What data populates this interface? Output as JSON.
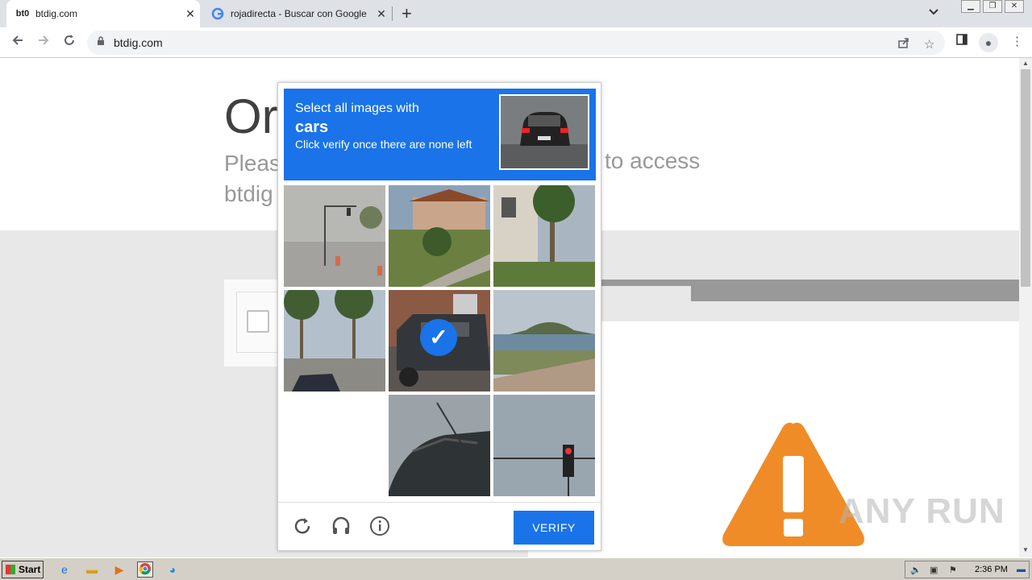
{
  "browser": {
    "tabs": [
      {
        "favicon": "bt0",
        "title": "btdig.com",
        "active": true
      },
      {
        "favicon": "G",
        "title": "rojadirecta - Buscar con Google",
        "active": false
      }
    ],
    "close_glyph": "✕",
    "new_tab_glyph": "+",
    "tab_search_glyph": "⌄",
    "url": "btdig.com"
  },
  "page": {
    "heading_partial": "Or",
    "subtext_left": "Pleas",
    "subtext_left2": "btdig",
    "subtext_right": "to access"
  },
  "captcha": {
    "instruction": "Select all images with",
    "target": "cars",
    "hint": "Click verify once there are none left",
    "verify_label": "VERIFY",
    "tiles": [
      {
        "desc": "street-traffic-light",
        "selected": false
      },
      {
        "desc": "house-lawn",
        "selected": false
      },
      {
        "desc": "palm-building",
        "selected": false
      },
      {
        "desc": "palm-street-car",
        "selected": false
      },
      {
        "desc": "jeep",
        "selected": true
      },
      {
        "desc": "coast-road",
        "selected": false
      },
      {
        "desc": "blank",
        "selected": false
      },
      {
        "desc": "car-closeup",
        "selected": false
      },
      {
        "desc": "traffic-light",
        "selected": false
      }
    ]
  },
  "taskbar": {
    "start_label": "Start",
    "clock": "2:36 PM"
  },
  "watermark": "ANY RUN",
  "colors": {
    "accent": "#1a73e8",
    "warning": "#f08c28"
  }
}
